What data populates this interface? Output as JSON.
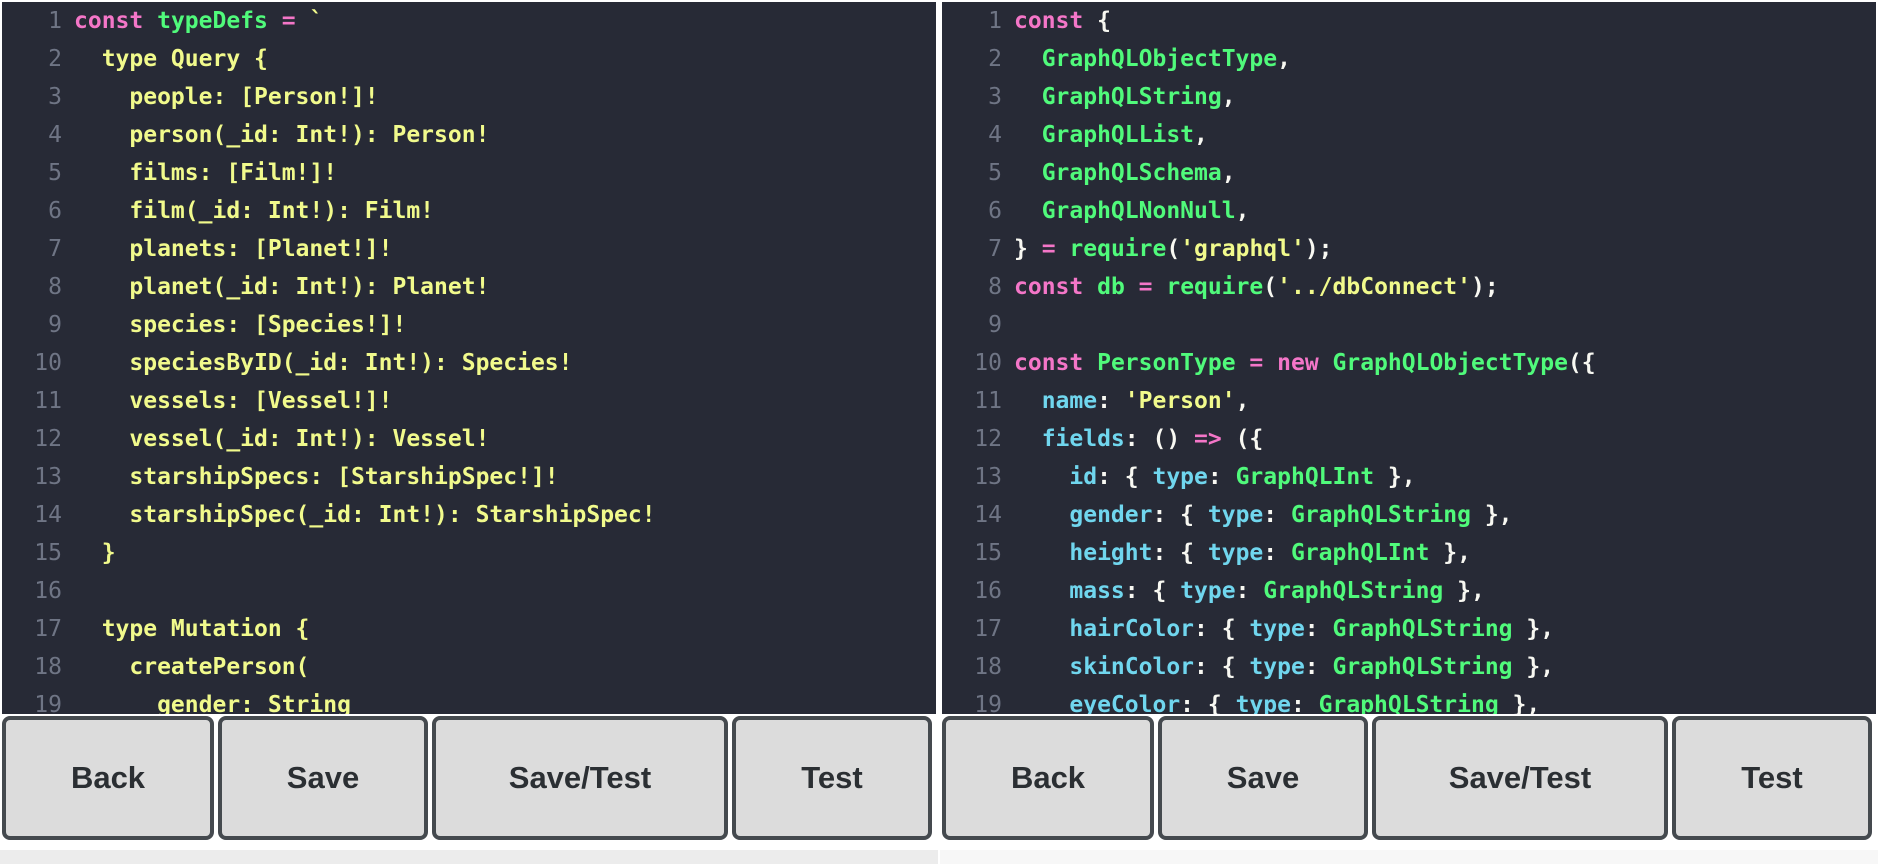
{
  "left_editor": {
    "lines": [
      {
        "n": "1",
        "tokens": [
          {
            "t": "const ",
            "c": "k"
          },
          {
            "t": "typeDefs",
            "c": "f"
          },
          {
            "t": " = ",
            "c": "k"
          },
          {
            "t": "`",
            "c": "y"
          }
        ]
      },
      {
        "n": "2",
        "tokens": [
          {
            "t": "  type Query {",
            "c": "y"
          }
        ]
      },
      {
        "n": "3",
        "tokens": [
          {
            "t": "    people: [Person!]!",
            "c": "y"
          }
        ]
      },
      {
        "n": "4",
        "tokens": [
          {
            "t": "    person(_id: Int!): Person!",
            "c": "y"
          }
        ]
      },
      {
        "n": "5",
        "tokens": [
          {
            "t": "    films: [Film!]!",
            "c": "y"
          }
        ]
      },
      {
        "n": "6",
        "tokens": [
          {
            "t": "    film(_id: Int!): Film!",
            "c": "y"
          }
        ]
      },
      {
        "n": "7",
        "tokens": [
          {
            "t": "    planets: [Planet!]!",
            "c": "y"
          }
        ]
      },
      {
        "n": "8",
        "tokens": [
          {
            "t": "    planet(_id: Int!): Planet!",
            "c": "y"
          }
        ]
      },
      {
        "n": "9",
        "tokens": [
          {
            "t": "    species: [Species!]!",
            "c": "y"
          }
        ]
      },
      {
        "n": "10",
        "tokens": [
          {
            "t": "    speciesByID(_id: Int!): Species!",
            "c": "y"
          }
        ]
      },
      {
        "n": "11",
        "tokens": [
          {
            "t": "    vessels: [Vessel!]!",
            "c": "y"
          }
        ]
      },
      {
        "n": "12",
        "tokens": [
          {
            "t": "    vessel(_id: Int!): Vessel!",
            "c": "y"
          }
        ]
      },
      {
        "n": "13",
        "tokens": [
          {
            "t": "    starshipSpecs: [StarshipSpec!]!",
            "c": "y"
          }
        ]
      },
      {
        "n": "14",
        "tokens": [
          {
            "t": "    starshipSpec(_id: Int!): StarshipSpec!",
            "c": "y"
          }
        ]
      },
      {
        "n": "15",
        "tokens": [
          {
            "t": "  }",
            "c": "y"
          }
        ]
      },
      {
        "n": "16",
        "tokens": []
      },
      {
        "n": "17",
        "tokens": [
          {
            "t": "  type Mutation {",
            "c": "y"
          }
        ]
      },
      {
        "n": "18",
        "tokens": [
          {
            "t": "    createPerson(",
            "c": "y"
          }
        ]
      },
      {
        "n": "19",
        "tokens": [
          {
            "t": "      gender: String",
            "c": "y"
          }
        ]
      }
    ]
  },
  "right_editor": {
    "lines": [
      {
        "n": "1",
        "tokens": [
          {
            "t": "const ",
            "c": "k"
          },
          {
            "t": "{",
            "c": "w"
          }
        ]
      },
      {
        "n": "2",
        "tokens": [
          {
            "t": "  GraphQLObjectType",
            "c": "f"
          },
          {
            "t": ",",
            "c": "w"
          }
        ]
      },
      {
        "n": "3",
        "tokens": [
          {
            "t": "  GraphQLString",
            "c": "f"
          },
          {
            "t": ",",
            "c": "w"
          }
        ]
      },
      {
        "n": "4",
        "tokens": [
          {
            "t": "  GraphQLList",
            "c": "f"
          },
          {
            "t": ",",
            "c": "w"
          }
        ]
      },
      {
        "n": "5",
        "tokens": [
          {
            "t": "  GraphQLSchema",
            "c": "f"
          },
          {
            "t": ",",
            "c": "w"
          }
        ]
      },
      {
        "n": "6",
        "tokens": [
          {
            "t": "  GraphQLNonNull",
            "c": "f"
          },
          {
            "t": ",",
            "c": "w"
          }
        ]
      },
      {
        "n": "7",
        "tokens": [
          {
            "t": "} ",
            "c": "w"
          },
          {
            "t": "= ",
            "c": "k"
          },
          {
            "t": "require",
            "c": "f"
          },
          {
            "t": "(",
            "c": "w"
          },
          {
            "t": "'graphql'",
            "c": "y"
          },
          {
            "t": ");",
            "c": "w"
          }
        ]
      },
      {
        "n": "8",
        "tokens": [
          {
            "t": "const ",
            "c": "k"
          },
          {
            "t": "db",
            "c": "f"
          },
          {
            "t": " = ",
            "c": "k"
          },
          {
            "t": "require",
            "c": "f"
          },
          {
            "t": "(",
            "c": "w"
          },
          {
            "t": "'../dbConnect'",
            "c": "y"
          },
          {
            "t": ");",
            "c": "w"
          }
        ]
      },
      {
        "n": "9",
        "tokens": []
      },
      {
        "n": "10",
        "tokens": [
          {
            "t": "const ",
            "c": "k"
          },
          {
            "t": "PersonType",
            "c": "f"
          },
          {
            "t": " = ",
            "c": "k"
          },
          {
            "t": "new ",
            "c": "k"
          },
          {
            "t": "GraphQLObjectType",
            "c": "f"
          },
          {
            "t": "({",
            "c": "w"
          }
        ]
      },
      {
        "n": "11",
        "tokens": [
          {
            "t": "  name",
            "c": "c"
          },
          {
            "t": ": ",
            "c": "w"
          },
          {
            "t": "'Person'",
            "c": "y"
          },
          {
            "t": ",",
            "c": "w"
          }
        ]
      },
      {
        "n": "12",
        "tokens": [
          {
            "t": "  fields",
            "c": "c"
          },
          {
            "t": ": () ",
            "c": "w"
          },
          {
            "t": "=>",
            "c": "k"
          },
          {
            "t": " ({",
            "c": "w"
          }
        ]
      },
      {
        "n": "13",
        "tokens": [
          {
            "t": "    id",
            "c": "c"
          },
          {
            "t": ": { ",
            "c": "w"
          },
          {
            "t": "type",
            "c": "c"
          },
          {
            "t": ": ",
            "c": "w"
          },
          {
            "t": "GraphQLInt",
            "c": "f"
          },
          {
            "t": " },",
            "c": "w"
          }
        ]
      },
      {
        "n": "14",
        "tokens": [
          {
            "t": "    gender",
            "c": "c"
          },
          {
            "t": ": { ",
            "c": "w"
          },
          {
            "t": "type",
            "c": "c"
          },
          {
            "t": ": ",
            "c": "w"
          },
          {
            "t": "GraphQLString",
            "c": "f"
          },
          {
            "t": " },",
            "c": "w"
          }
        ]
      },
      {
        "n": "15",
        "tokens": [
          {
            "t": "    height",
            "c": "c"
          },
          {
            "t": ": { ",
            "c": "w"
          },
          {
            "t": "type",
            "c": "c"
          },
          {
            "t": ": ",
            "c": "w"
          },
          {
            "t": "GraphQLInt",
            "c": "f"
          },
          {
            "t": " },",
            "c": "w"
          }
        ]
      },
      {
        "n": "16",
        "tokens": [
          {
            "t": "    mass",
            "c": "c"
          },
          {
            "t": ": { ",
            "c": "w"
          },
          {
            "t": "type",
            "c": "c"
          },
          {
            "t": ": ",
            "c": "w"
          },
          {
            "t": "GraphQLString",
            "c": "f"
          },
          {
            "t": " },",
            "c": "w"
          }
        ]
      },
      {
        "n": "17",
        "tokens": [
          {
            "t": "    hairColor",
            "c": "c"
          },
          {
            "t": ": { ",
            "c": "w"
          },
          {
            "t": "type",
            "c": "c"
          },
          {
            "t": ": ",
            "c": "w"
          },
          {
            "t": "GraphQLString",
            "c": "f"
          },
          {
            "t": " },",
            "c": "w"
          }
        ]
      },
      {
        "n": "18",
        "tokens": [
          {
            "t": "    skinColor",
            "c": "c"
          },
          {
            "t": ": { ",
            "c": "w"
          },
          {
            "t": "type",
            "c": "c"
          },
          {
            "t": ": ",
            "c": "w"
          },
          {
            "t": "GraphQLString",
            "c": "f"
          },
          {
            "t": " },",
            "c": "w"
          }
        ]
      },
      {
        "n": "19",
        "tokens": [
          {
            "t": "    eyeColor",
            "c": "c"
          },
          {
            "t": ": { ",
            "c": "w"
          },
          {
            "t": "type",
            "c": "c"
          },
          {
            "t": ": ",
            "c": "w"
          },
          {
            "t": "GraphQLString",
            "c": "f"
          },
          {
            "t": " },",
            "c": "w"
          }
        ]
      }
    ]
  },
  "left_toolbar": {
    "back_label": "Back",
    "save_label": "Save",
    "save_test_label": "Save/Test",
    "test_label": "Test"
  },
  "right_toolbar": {
    "back_label": "Back",
    "save_label": "Save",
    "save_test_label": "Save/Test",
    "test_label": "Test"
  },
  "colors": {
    "editor_bg": "#272a36",
    "keyword": "#f476c8",
    "function": "#50fa7b",
    "string": "#f1fa8c",
    "property": "#70d6ee",
    "punctuation": "#f8f8f2",
    "button_bg": "#dcdcdc",
    "button_border": "#454a4f"
  }
}
